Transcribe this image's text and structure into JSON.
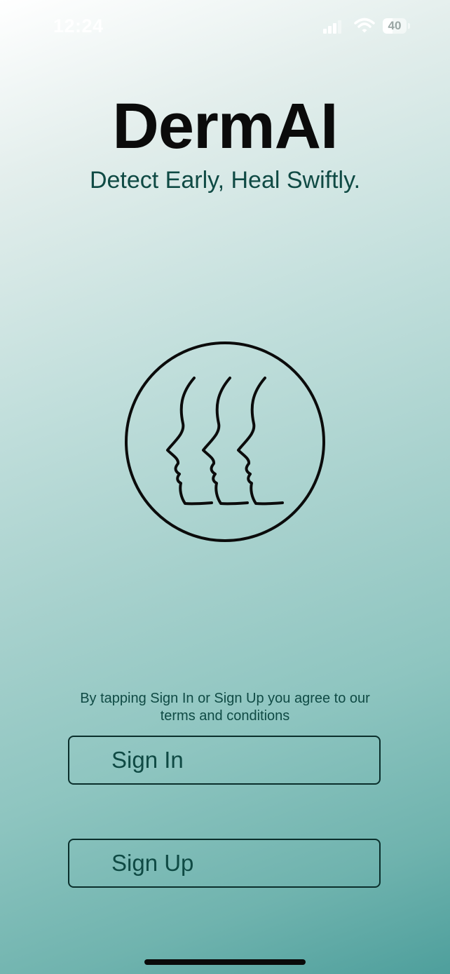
{
  "status_bar": {
    "time": "12:24",
    "battery_level": "40",
    "battery_fraction": 0.4,
    "signal_bars_active": 3,
    "signal_bars_total": 4
  },
  "app": {
    "title": "DermAI",
    "tagline": "Detect Early, Heal Swiftly."
  },
  "logo": {
    "icon": "three-face-profiles-icon"
  },
  "auth": {
    "terms_line1": "By tapping Sign In or Sign Up you agree to our",
    "terms_line2": "terms and conditions",
    "sign_in_label": "Sign In",
    "sign_up_label": "Sign Up"
  },
  "colors": {
    "text_dark": "#0b0b0b",
    "accent_text": "#0f4a44",
    "gradient_top": "#ffffff",
    "gradient_bottom": "#4e9f9c"
  }
}
